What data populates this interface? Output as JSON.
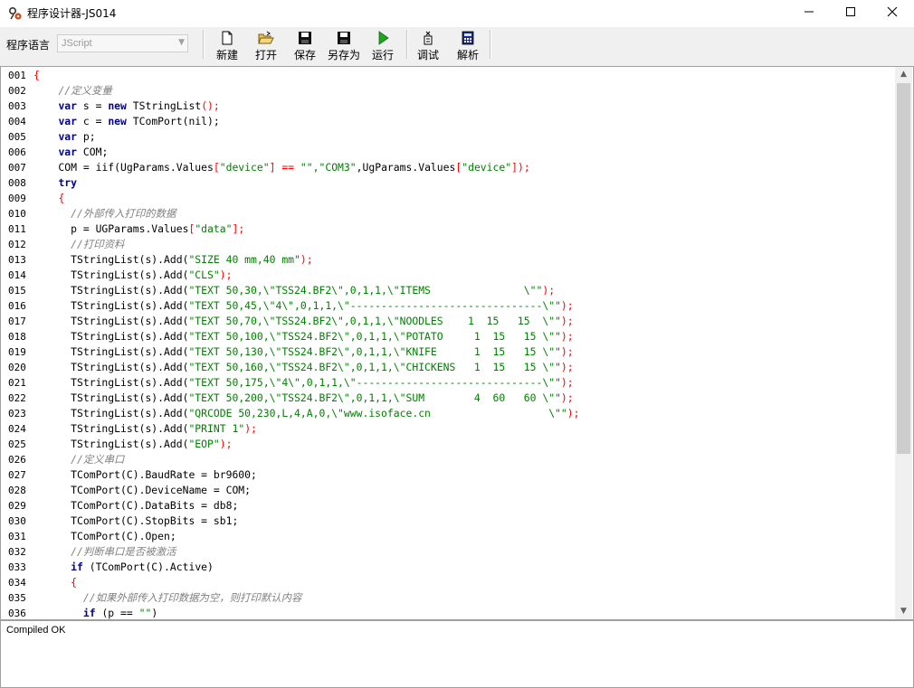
{
  "window": {
    "title": "程序设计器-JS014",
    "minimize": "—",
    "maximize": "☐",
    "close": "✕"
  },
  "toolbar": {
    "lang_label": "程序语言",
    "lang_value": "JScript",
    "buttons": [
      {
        "label": "新建",
        "icon": "new-file-icon"
      },
      {
        "label": "打开",
        "icon": "open-folder-icon"
      },
      {
        "label": "保存",
        "icon": "save-disk-icon"
      },
      {
        "label": "另存为",
        "icon": "save-as-disk-icon"
      },
      {
        "label": "运行",
        "icon": "run-play-icon"
      },
      {
        "label": "调试",
        "icon": "debug-icon"
      },
      {
        "label": "解析",
        "icon": "parse-calculator-icon"
      }
    ]
  },
  "editor": {
    "lines": [
      "001",
      "002",
      "003",
      "004",
      "005",
      "006",
      "007",
      "008",
      "009",
      "010",
      "011",
      "012",
      "013",
      "014",
      "015",
      "016",
      "017",
      "018",
      "019",
      "020",
      "021",
      "022",
      "023",
      "024",
      "025",
      "026",
      "027",
      "028",
      "029",
      "030",
      "031",
      "032",
      "033",
      "034",
      "035",
      "036"
    ],
    "code": [
      [
        [
          "sym",
          "{"
        ]
      ],
      [
        [
          "t",
          "    "
        ],
        [
          "cm",
          "//定义变量"
        ]
      ],
      [
        [
          "t",
          "    "
        ],
        [
          "kw",
          "var"
        ],
        [
          "t",
          " s = "
        ],
        [
          "kw",
          "new"
        ],
        [
          "t",
          " TStringList"
        ],
        [
          "sym",
          "();"
        ]
      ],
      [
        [
          "t",
          "    "
        ],
        [
          "kw",
          "var"
        ],
        [
          "t",
          " c = "
        ],
        [
          "kw",
          "new"
        ],
        [
          "t",
          " TComPort(nil);"
        ]
      ],
      [
        [
          "t",
          "    "
        ],
        [
          "kw",
          "var"
        ],
        [
          "t",
          " p;"
        ]
      ],
      [
        [
          "t",
          "    "
        ],
        [
          "kw",
          "var"
        ],
        [
          "t",
          " COM;"
        ]
      ],
      [
        [
          "t",
          "    COM = iif(UgParams.Values"
        ],
        [
          "sym",
          "["
        ],
        [
          "str",
          "\"device\""
        ],
        [
          "sym",
          "] == "
        ],
        [
          "str",
          "\"\",\"COM3\""
        ],
        [
          "t",
          ",UgParams.Values"
        ],
        [
          "sym",
          "["
        ],
        [
          "str",
          "\"device\""
        ],
        [
          "sym",
          "]);"
        ]
      ],
      [
        [
          "t",
          "    "
        ],
        [
          "kw",
          "try"
        ]
      ],
      [
        [
          "t",
          "    "
        ],
        [
          "sym",
          "{"
        ]
      ],
      [
        [
          "t",
          "      "
        ],
        [
          "cm",
          "//外部传入打印的数据"
        ]
      ],
      [
        [
          "t",
          "      p = UGParams.Values"
        ],
        [
          "sym",
          "["
        ],
        [
          "str",
          "\"data\""
        ],
        [
          "sym",
          "];"
        ]
      ],
      [
        [
          "t",
          "      "
        ],
        [
          "cm",
          "//打印资料"
        ]
      ],
      [
        [
          "t",
          "      TStringList(s).Add("
        ],
        [
          "str",
          "\"SIZE 40 mm,40 mm\""
        ],
        [
          "sym",
          ");"
        ]
      ],
      [
        [
          "t",
          "      TStringList(s).Add("
        ],
        [
          "str",
          "\"CLS\""
        ],
        [
          "sym",
          ");"
        ]
      ],
      [
        [
          "t",
          "      TStringList(s).Add("
        ],
        [
          "str",
          "\"TEXT 50,30,\\\"TSS24.BF2\\\",0,1,1,\\\"ITEMS               \\\"\""
        ],
        [
          "sym",
          ");"
        ]
      ],
      [
        [
          "t",
          "      TStringList(s).Add("
        ],
        [
          "str",
          "\"TEXT 50,45,\\\"4\\\",0,1,1,\\\"-------------------------------\\\"\""
        ],
        [
          "sym",
          ");"
        ]
      ],
      [
        [
          "t",
          "      TStringList(s).Add("
        ],
        [
          "str",
          "\"TEXT 50,70,\\\"TSS24.BF2\\\",0,1,1,\\\"NOODLES    1  15   15  \\\"\""
        ],
        [
          "sym",
          ");"
        ]
      ],
      [
        [
          "t",
          "      TStringList(s).Add("
        ],
        [
          "str",
          "\"TEXT 50,100,\\\"TSS24.BF2\\\",0,1,1,\\\"POTATO     1  15   15 \\\"\""
        ],
        [
          "sym",
          ");"
        ]
      ],
      [
        [
          "t",
          "      TStringList(s).Add("
        ],
        [
          "str",
          "\"TEXT 50,130,\\\"TSS24.BF2\\\",0,1,1,\\\"KNIFE      1  15   15 \\\"\""
        ],
        [
          "sym",
          ");"
        ]
      ],
      [
        [
          "t",
          "      TStringList(s).Add("
        ],
        [
          "str",
          "\"TEXT 50,160,\\\"TSS24.BF2\\\",0,1,1,\\\"CHICKENS   1  15   15 \\\"\""
        ],
        [
          "sym",
          ");"
        ]
      ],
      [
        [
          "t",
          "      TStringList(s).Add("
        ],
        [
          "str",
          "\"TEXT 50,175,\\\"4\\\",0,1,1,\\\"------------------------------\\\"\""
        ],
        [
          "sym",
          ");"
        ]
      ],
      [
        [
          "t",
          "      TStringList(s).Add("
        ],
        [
          "str",
          "\"TEXT 50,200,\\\"TSS24.BF2\\\",0,1,1,\\\"SUM        4  60   60 \\\"\""
        ],
        [
          "sym",
          ");"
        ]
      ],
      [
        [
          "t",
          "      TStringList(s).Add("
        ],
        [
          "str",
          "\"QRCODE 50,230,L,4,A,0,\\\"www.isoface.cn                   \\\"\""
        ],
        [
          "sym",
          ");"
        ]
      ],
      [
        [
          "t",
          "      TStringList(s).Add("
        ],
        [
          "str",
          "\"PRINT 1\""
        ],
        [
          "sym",
          ");"
        ]
      ],
      [
        [
          "t",
          "      TStringList(s).Add("
        ],
        [
          "str",
          "\"EOP\""
        ],
        [
          "sym",
          ");"
        ]
      ],
      [
        [
          "t",
          "      "
        ],
        [
          "cm",
          "//定义串口"
        ]
      ],
      [
        [
          "t",
          "      TComPort(C).BaudRate = br9600;"
        ]
      ],
      [
        [
          "t",
          "      TComPort(C).DeviceName = COM;"
        ]
      ],
      [
        [
          "t",
          "      TComPort(C).DataBits = db8;"
        ]
      ],
      [
        [
          "t",
          "      TComPort(C).StopBits = sb1;"
        ]
      ],
      [
        [
          "t",
          "      TComPort(C).Open;"
        ]
      ],
      [
        [
          "t",
          "      "
        ],
        [
          "cm",
          "//判断串口是否被激活"
        ]
      ],
      [
        [
          "t",
          "      "
        ],
        [
          "kw",
          "if"
        ],
        [
          "t",
          " (TComPort(C).Active)"
        ]
      ],
      [
        [
          "t",
          "      "
        ],
        [
          "sym",
          "{"
        ]
      ],
      [
        [
          "t",
          "        "
        ],
        [
          "cm",
          "//如果外部传入打印数据为空，则打印默认内容"
        ]
      ],
      [
        [
          "t",
          "        "
        ],
        [
          "kw",
          "if"
        ],
        [
          "t",
          " (p == "
        ],
        [
          "str",
          "\"\""
        ],
        [
          "t",
          ")"
        ]
      ]
    ]
  },
  "output": {
    "message": "Compiled OK"
  }
}
